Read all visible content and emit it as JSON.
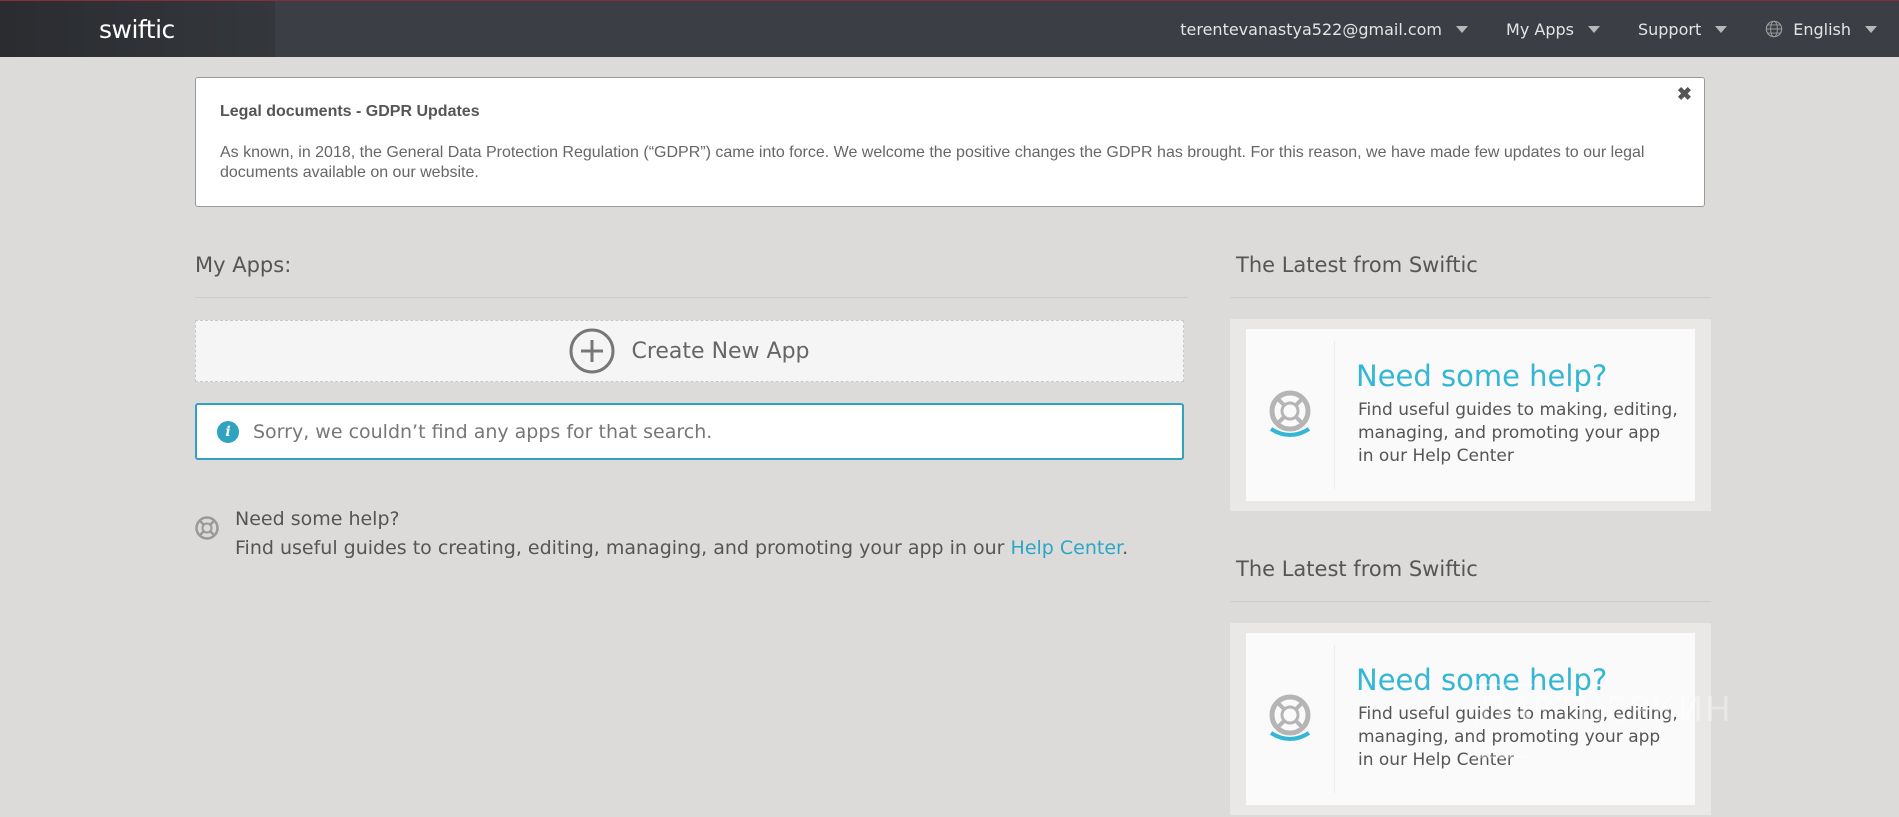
{
  "header": {
    "logo": "swiftic",
    "account": "terentevanastya522@gmail.com",
    "my_apps": "My Apps",
    "support": "Support",
    "language": "English"
  },
  "notice": {
    "title": "Legal documents - GDPR Updates",
    "body": "As known, in 2018, the General Data Protection Regulation (“GDPR”) came into force. We welcome the positive changes the GDPR has brought. For this reason, we have made few updates to our legal documents available on our website.",
    "close": "✖"
  },
  "my_apps": {
    "title": "My Apps:",
    "create_label": "Create New App",
    "empty_message": "Sorry, we couldn’t find any apps for that search.",
    "help_title": "Need some help?",
    "help_text_prefix": "Find useful guides to creating, editing, managing, and promoting your app in our ",
    "help_link": "Help Center",
    "help_text_suffix": "."
  },
  "latest": [
    {
      "title": "The Latest from Swiftic",
      "card_title": "Need some help?",
      "card_text": "Find useful guides to making, editing, managing, and promoting your app in our Help Center"
    },
    {
      "title": "The Latest from Swiftic",
      "card_title": "Need some help?",
      "card_text": "Find useful guides to making, editing, managing, and promoting your app in our Help Center"
    }
  ],
  "watermark": "ПАРТНЕРКИН",
  "colors": {
    "accent": "#34b6d5",
    "topbar": "#3b3e44",
    "background": "#dddbd9"
  }
}
